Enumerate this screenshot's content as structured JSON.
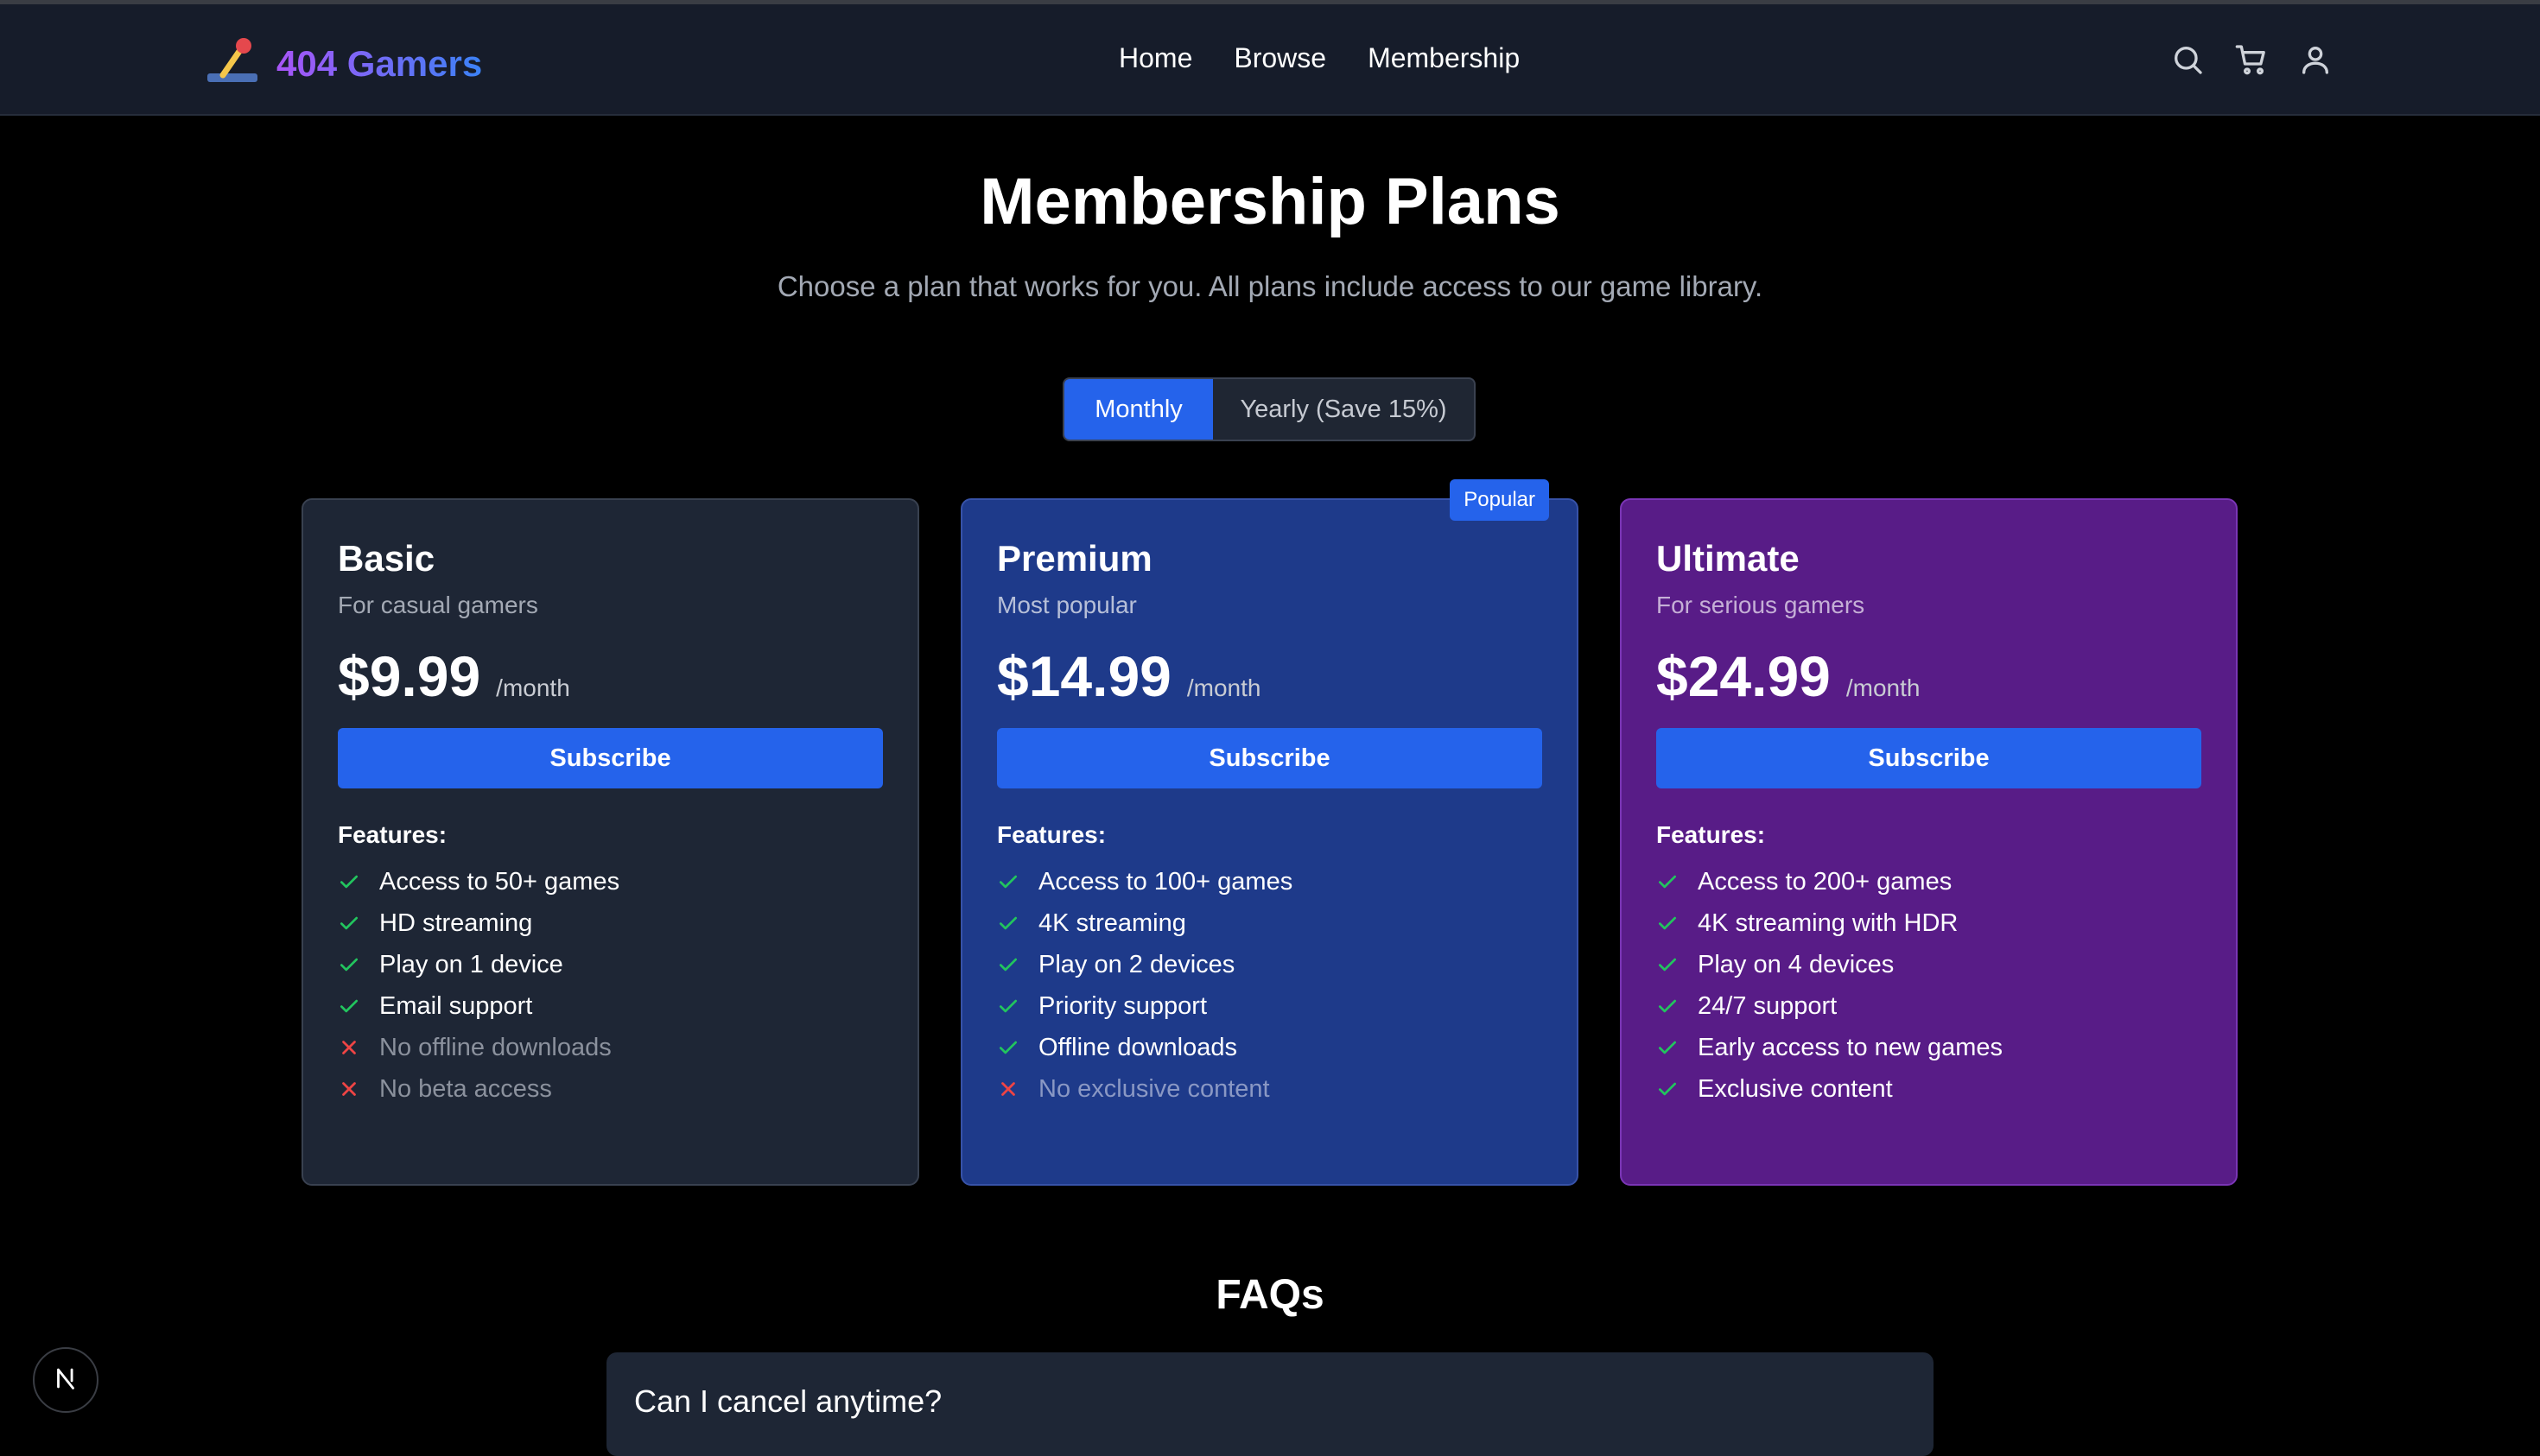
{
  "header": {
    "brand": "404 Gamers",
    "nav": [
      {
        "label": "Home"
      },
      {
        "label": "Browse"
      },
      {
        "label": "Membership"
      }
    ],
    "icons": [
      "search-icon",
      "cart-icon",
      "user-icon"
    ]
  },
  "page": {
    "title": "Membership Plans",
    "subtitle": "Choose a plan that works for you. All plans include access to our game library."
  },
  "billing_toggle": {
    "options": [
      "Monthly",
      "Yearly (Save 15%)"
    ],
    "selected": "Monthly"
  },
  "plans": [
    {
      "name": "Basic",
      "description": "For casual gamers",
      "price": "$9.99",
      "period": "/month",
      "cta": "Subscribe",
      "features_title": "Features:",
      "features": [
        {
          "text": "Access to 50+ games",
          "included": true
        },
        {
          "text": "HD streaming",
          "included": true
        },
        {
          "text": "Play on 1 device",
          "included": true
        },
        {
          "text": "Email support",
          "included": true
        },
        {
          "text": "No offline downloads",
          "included": false
        },
        {
          "text": "No beta access",
          "included": false
        }
      ]
    },
    {
      "name": "Premium",
      "description": "Most popular",
      "badge": "Popular",
      "price": "$14.99",
      "period": "/month",
      "cta": "Subscribe",
      "features_title": "Features:",
      "features": [
        {
          "text": "Access to 100+ games",
          "included": true
        },
        {
          "text": "4K streaming",
          "included": true
        },
        {
          "text": "Play on 2 devices",
          "included": true
        },
        {
          "text": "Priority support",
          "included": true
        },
        {
          "text": "Offline downloads",
          "included": true
        },
        {
          "text": "No exclusive content",
          "included": false
        }
      ]
    },
    {
      "name": "Ultimate",
      "description": "For serious gamers",
      "price": "$24.99",
      "period": "/month",
      "cta": "Subscribe",
      "features_title": "Features:",
      "features": [
        {
          "text": "Access to 200+ games",
          "included": true
        },
        {
          "text": "4K streaming with HDR",
          "included": true
        },
        {
          "text": "Play on 4 devices",
          "included": true
        },
        {
          "text": "24/7 support",
          "included": true
        },
        {
          "text": "Early access to new games",
          "included": true
        },
        {
          "text": "Exclusive content",
          "included": true
        }
      ]
    }
  ],
  "faq": {
    "title": "FAQs",
    "items": [
      {
        "question": "Can I cancel anytime?"
      }
    ]
  },
  "colors": {
    "accent": "#2563eb",
    "check": "#22c55e",
    "cross": "#ef4444",
    "basic_card": "#1e2635",
    "premium_card": "#1e3a8a",
    "ultimate_card": "#581c87"
  }
}
